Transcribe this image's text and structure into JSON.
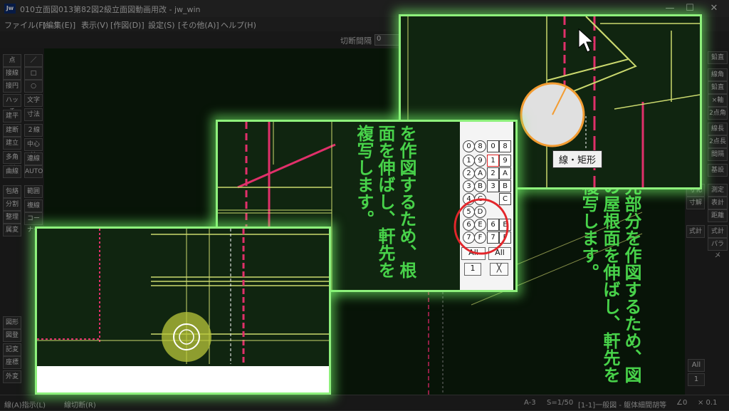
{
  "window": {
    "title": "010立面図013第82図2級立面図動画用改 - jw_win",
    "icon_text": "Jw",
    "minimize": "—",
    "maximize": "☐",
    "close": "✕"
  },
  "menu": [
    "ファイル(F)",
    "[編集(E)]",
    "表示(V)",
    "[作図(D)]",
    "設定(S)",
    "[その他(A)]",
    "ヘルプ(H)"
  ],
  "subbar": {
    "label": "切断間隔",
    "value": "0"
  },
  "left_toolbar": {
    "col1": [
      "点",
      "接線",
      "接円",
      "ハッチ",
      "建平",
      "建断",
      "建立",
      "多角形",
      "曲線",
      "包絡",
      "分割",
      "整理",
      "属変",
      "図形",
      "図登",
      "記変",
      "座標",
      "外変"
    ],
    "col2": [
      "／",
      "□",
      "○",
      "文字",
      "寸法",
      "２線",
      "中心線",
      "連線",
      "AUTO",
      "範囲",
      "複線",
      "コーナー"
    ]
  },
  "right_toolbar": {
    "col1": [
      "寸化",
      "寸解",
      "式計"
    ],
    "col2": [
      "鉛直",
      "線角",
      "鉛直",
      "×軸",
      "2点角",
      "線長",
      "2点長",
      "間隔",
      "基設",
      "測定",
      "表計",
      "距離",
      "式計",
      "パラメ"
    ],
    "layer_all": "All",
    "layer_num": "1"
  },
  "status": {
    "left": "線(A)指示(L)",
    "mid": "線切断(R)",
    "a": "A-3",
    "scale": "S=1/50",
    "layer": "[1-1]一般図 - 躯体細間胡等",
    "angle": "∠0",
    "zoom": "× 0.1"
  },
  "captions": {
    "background": "先部分を作図するため、図の屋根面を伸ばし、軒先を複写します。",
    "center": "を作図するため、根面を伸ばし、軒先を複写します。"
  },
  "tooltip": "線・矩形",
  "layer_grid": {
    "left": [
      "0",
      "1",
      "2",
      "3",
      "4",
      "5",
      "6",
      "7"
    ],
    "mid": [
      "8",
      "9",
      "A",
      "B",
      "C",
      "D",
      "E",
      "F"
    ],
    "right_num": [
      "0",
      "1",
      "2",
      "3",
      "4",
      "5",
      "6",
      "7"
    ],
    "right_hex": [
      "8",
      "9",
      "A",
      "B",
      "C",
      "D",
      "E",
      "F"
    ],
    "all": "All",
    "num": "1",
    "x": "╳"
  },
  "colors": {
    "accent_green": "#8ef07c",
    "text_green": "#48d24a",
    "magenta_line": "#e0306a",
    "yellow_line": "#cbd96e",
    "highlight_red": "#e2262b"
  }
}
